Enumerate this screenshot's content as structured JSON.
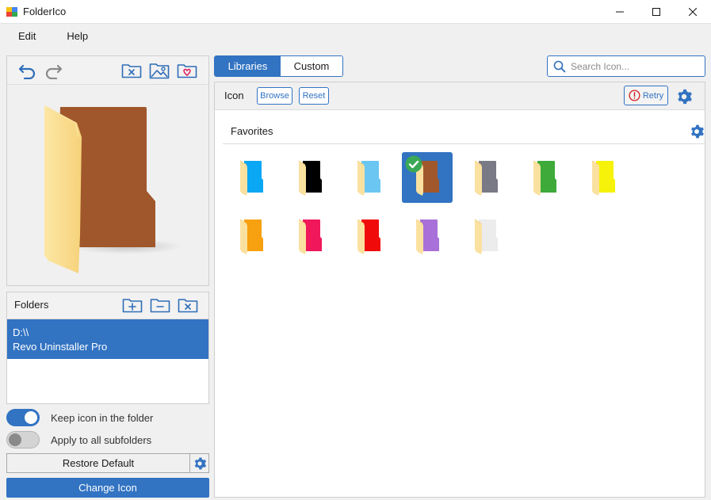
{
  "window": {
    "title": "FolderIco",
    "logo": "foldercio-logo-icon"
  },
  "menu": {
    "items": [
      "Edit",
      "Help"
    ]
  },
  "left": {
    "toolbar_icons": [
      "undo-icon",
      "redo-icon",
      "clear-folder-icon",
      "image-icon",
      "favorite-icon"
    ],
    "preview_folder_color": "#a0572b",
    "folders": {
      "title": "Folders",
      "entry_path": "D:\\\\",
      "entry_name": "Revo Uninstaller Pro"
    },
    "toggles": [
      {
        "label": "Keep icon in the folder",
        "on": true
      },
      {
        "label": "Apply to all subfolders",
        "on": false
      }
    ],
    "restore_label": "Restore Default",
    "change_label": "Change Icon"
  },
  "tabs": [
    {
      "label": "Libraries",
      "active": true
    },
    {
      "label": "Custom",
      "active": false
    }
  ],
  "search": {
    "placeholder": "Search Icon..."
  },
  "icon_bar": {
    "label": "Icon",
    "browse_label": "Browse",
    "reset_label": "Reset",
    "retry_label": "Retry"
  },
  "favorites": {
    "title": "Favorites",
    "icons": [
      {
        "color": "#0aa7f4",
        "selected": false
      },
      {
        "color": "#000000",
        "selected": false
      },
      {
        "color": "#6cc6f2",
        "selected": false
      },
      {
        "color": "#a0572b",
        "selected": true
      },
      {
        "color": "#7a7a86",
        "selected": false
      },
      {
        "color": "#3daa3a",
        "selected": false
      },
      {
        "color": "#f6f20a",
        "selected": false
      },
      {
        "color": "#f7a010",
        "selected": false
      },
      {
        "color": "#f0185a",
        "selected": false
      },
      {
        "color": "#f00a0a",
        "selected": false
      },
      {
        "color": "#a870d8",
        "selected": false
      },
      {
        "color": "#ececec",
        "selected": false
      }
    ]
  },
  "colors": {
    "accent": "#3273c2",
    "check": "#3aa856"
  }
}
